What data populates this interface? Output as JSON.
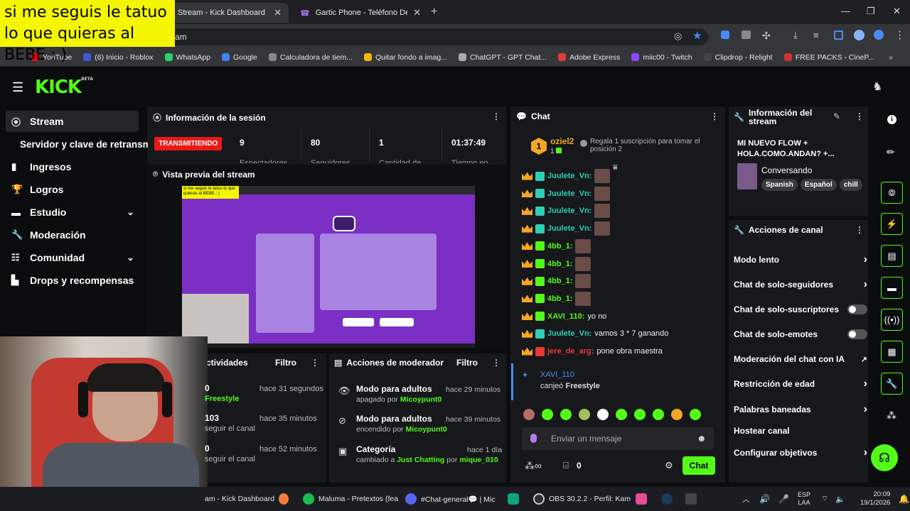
{
  "overlay_caption": "si me seguis le tatuo lo que quieras al BEBE : )",
  "browser": {
    "tabs": [
      {
        "title": "Stream - Kick Dashboard",
        "active": true
      },
      {
        "title": "Gartic Phone - Teléfono Descon",
        "active": false
      }
    ],
    "url_fragment": "am",
    "bookmarks": [
      "YouTube",
      "(6) Inicio - Roblox",
      "WhatsApp",
      "Google",
      "Calculadora de tiem...",
      "Quitar fondo a imag...",
      "ChatGPT - GPT Chat...",
      "Adobe Express",
      "miic00 - Twitch",
      "Clipdrop - Relight",
      "FREE PACKS - CineP..."
    ],
    "bookmark_colors": [
      "#ff0000",
      "#3b5bdb",
      "#25d366",
      "#4285f4",
      "#888888",
      "#f7b500",
      "#aaaaaa",
      "#e43c3c",
      "#9146ff",
      "#444444",
      "#cc3333"
    ]
  },
  "kick": {
    "logo": "KICK",
    "logo_tag": "BETA",
    "accent": "#53fc18"
  },
  "sidebar": {
    "items": [
      {
        "label": "Stream",
        "icon": "broadcast-icon",
        "active": true
      },
      {
        "label": "Servidor y clave de retransm",
        "icon": ""
      },
      {
        "label": "Ingresos",
        "icon": "chart-icon"
      },
      {
        "label": "Logros",
        "icon": "trophy-icon"
      },
      {
        "label": "Estudio",
        "icon": "studio-icon",
        "expand": true
      },
      {
        "label": "Moderación",
        "icon": "wrench-icon"
      },
      {
        "label": "Comunidad",
        "icon": "community-icon",
        "expand": true
      },
      {
        "label": "Drops y recompensas",
        "icon": "drops-icon"
      }
    ]
  },
  "session": {
    "title": "Información de la sesión",
    "status": "TRANSMITIENDO",
    "stats": [
      {
        "value": "9",
        "label": "Espectadores"
      },
      {
        "value": "80",
        "label": "Seguidores"
      },
      {
        "value": "1",
        "label": "Cantidad de"
      },
      {
        "value": "01:37:49",
        "label": "Tiempo en"
      }
    ]
  },
  "preview": {
    "title": "Vista previa del stream",
    "mini_caption": "si me seguis le tatuo lo que quieras al BEBE : )"
  },
  "activity": {
    "title": "ctividades",
    "filter": "Filtro",
    "rows": [
      {
        "name": "0",
        "action": "Freestyle",
        "time": "hace 31 segundos"
      },
      {
        "name": "103",
        "action": "seguir el canal",
        "time": "hace 35 minutos"
      },
      {
        "name": "0",
        "action": "seguir el canal",
        "time": "hace 52 minutos"
      }
    ]
  },
  "mod_actions": {
    "title": "Acciones de moderador",
    "filter": "Filtro",
    "rows": [
      {
        "title": "Modo para adultos",
        "desc": "apagado por",
        "user": "Micoypunt0",
        "time": "hace 29 minutos"
      },
      {
        "title": "Modo para adultos",
        "desc": "encendido por",
        "user": "Micoypunt0",
        "time": "hace 39 minutos"
      },
      {
        "title": "Categoría",
        "desc": "cambiado a",
        "user": "Just Chatting",
        "desc2": "por",
        "user2": "mique_010",
        "time": "hace 1 día"
      }
    ]
  },
  "chat": {
    "title": "Chat",
    "pinned_user": "oziel2",
    "pinned_count": "1",
    "pinned_rank": "1",
    "pinned_text": "Regala 1 suscripción para tomar el posición 2",
    "messages": [
      {
        "user": "Juulete_Vn:",
        "color": "#2ecfb4",
        "text": "",
        "emote": true
      },
      {
        "user": "Juulete_Vn:",
        "color": "#2ecfb4",
        "text": "",
        "emote": true
      },
      {
        "user": "Juulete_Vn:",
        "color": "#2ecfb4",
        "text": "",
        "emote": true
      },
      {
        "user": "Juulete_Vn:",
        "color": "#2ecfb4",
        "text": "",
        "emote": true
      },
      {
        "user": "4bb_1:",
        "color": "#53fc18",
        "text": "",
        "emote": true
      },
      {
        "user": "4bb_1:",
        "color": "#53fc18",
        "text": "",
        "emote": true
      },
      {
        "user": "4bb_1:",
        "color": "#53fc18",
        "text": "",
        "emote": true
      },
      {
        "user": "4bb_1:",
        "color": "#53fc18",
        "text": "",
        "emote": true
      },
      {
        "user": "XAVI_110:",
        "color": "#53fc18",
        "text": "yo no",
        "emote": false
      },
      {
        "user": "Juulete_Vn:",
        "color": "#2ecfb4",
        "text": "vamos 3 * 7 ganando",
        "emote": false
      },
      {
        "user": "jere_de_arg:",
        "color": "#e53935",
        "text": "pone obra maestra",
        "emote": false
      }
    ],
    "redeem_user": "XAVI_110",
    "redeem_text": "canjeó",
    "redeem_item": "Freestyle",
    "input_placeholder": "Enviar un mensaje",
    "points": "0",
    "send_label": "Chat"
  },
  "stream_info": {
    "title": "Información del stream",
    "stream_title": "MI NUEVO FLOW + HOLA.COMO.ANDAN? +...",
    "category": "Conversando",
    "tags": [
      "Spanish",
      "Español",
      "chill"
    ]
  },
  "channel_actions": {
    "title": "Acciones de canal",
    "items": [
      {
        "label": "Modo lento",
        "ctrl": "chevron"
      },
      {
        "label": "Chat de solo-seguidores",
        "ctrl": "chevron"
      },
      {
        "label": "Chat de solo-suscriptores",
        "ctrl": "toggle"
      },
      {
        "label": "Chat de solo-emotes",
        "ctrl": "toggle"
      },
      {
        "label": "Moderación del chat con IA",
        "ctrl": "external"
      },
      {
        "label": "Restricción de edad",
        "ctrl": "chevron"
      },
      {
        "label": "Palabras baneadas",
        "ctrl": "chevron"
      },
      {
        "label": "Hostear canal",
        "ctrl": "none"
      },
      {
        "label": "Configurar objetivos",
        "ctrl": "chevron"
      }
    ]
  },
  "taskbar": {
    "items": [
      {
        "label": "am - Kick Dashboard"
      },
      {
        "label": "Maluma - Pretextos (fea"
      },
      {
        "label": "#Chat-general💬 | Mic"
      },
      {
        "label": "OBS 30.2.2 - Perfil: Kam"
      }
    ],
    "lang": "ESP",
    "lang2": "LAA",
    "time": "20:09",
    "date": "19/1/2026"
  }
}
